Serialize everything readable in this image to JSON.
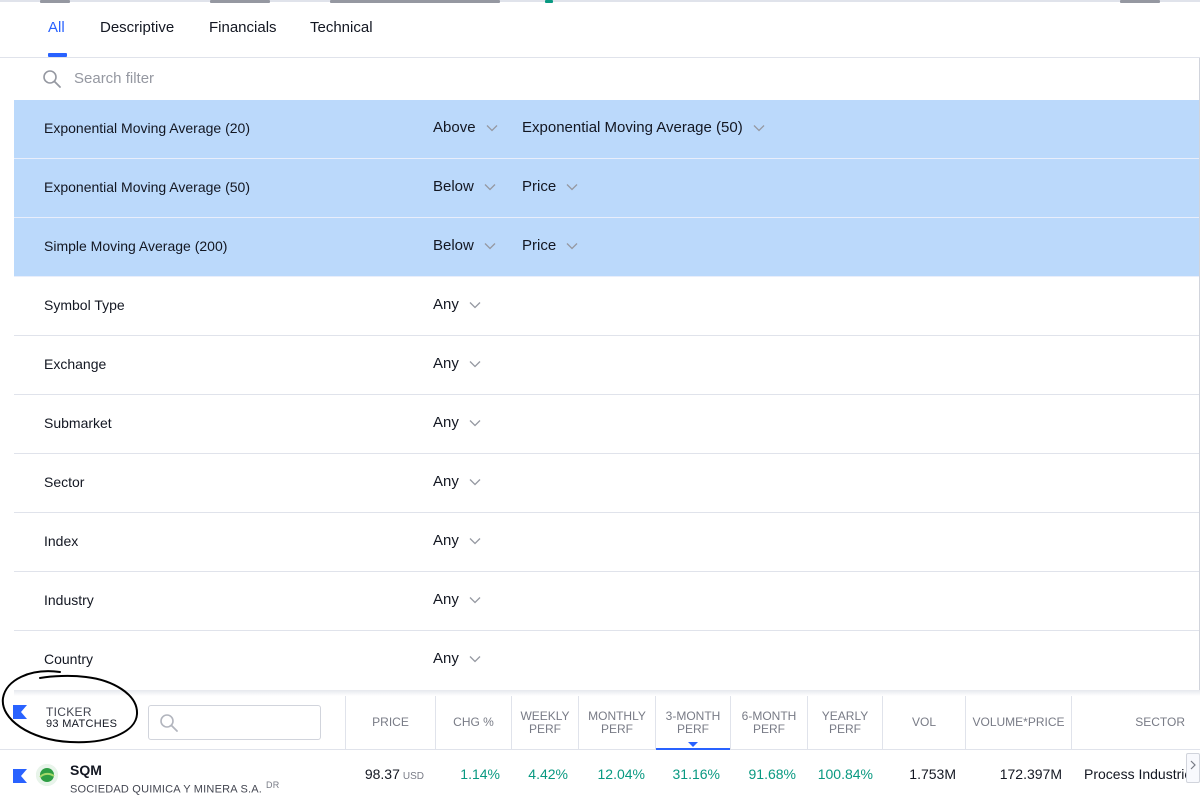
{
  "tabs": [
    {
      "label": "All",
      "active": true
    },
    {
      "label": "Descriptive",
      "active": false
    },
    {
      "label": "Financials",
      "active": false
    },
    {
      "label": "Technical",
      "active": false
    }
  ],
  "search": {
    "placeholder": "Search filter"
  },
  "filters": [
    {
      "name": "Exponential Moving Average (20)",
      "operator": "Above",
      "value": "Exponential Moving Average (50)",
      "active": true
    },
    {
      "name": "Exponential Moving Average (50)",
      "operator": "Below",
      "value": "Price",
      "active": true
    },
    {
      "name": "Simple Moving Average (200)",
      "operator": "Below",
      "value": "Price",
      "active": true
    },
    {
      "name": "Symbol Type",
      "operator": "Any",
      "active": false
    },
    {
      "name": "Exchange",
      "operator": "Any",
      "active": false
    },
    {
      "name": "Submarket",
      "operator": "Any",
      "active": false
    },
    {
      "name": "Sector",
      "operator": "Any",
      "active": false
    },
    {
      "name": "Index",
      "operator": "Any",
      "active": false
    },
    {
      "name": "Industry",
      "operator": "Any",
      "active": false
    },
    {
      "name": "Country",
      "operator": "Any",
      "active": false
    }
  ],
  "table": {
    "ticker_label": "TICKER",
    "matches_label": "93 MATCHES",
    "columns": [
      {
        "label": "PRICE"
      },
      {
        "label": "CHG %"
      },
      {
        "label": "WEEKLY PERF"
      },
      {
        "label": "MONTHLY PERF"
      },
      {
        "label": "3-MONTH PERF",
        "sorted": true
      },
      {
        "label": "6-MONTH PERF"
      },
      {
        "label": "YEARLY PERF"
      },
      {
        "label": "VOL"
      },
      {
        "label": "VOLUME*PRICE"
      },
      {
        "label": "SECTOR"
      }
    ],
    "rows": [
      {
        "symbol": "SQM",
        "description": "SOCIEDAD QUIMICA Y MINERA S.A.",
        "badge": "DR",
        "price": "98.37",
        "price_unit": "USD",
        "chg": "1.14%",
        "weekly": "4.42%",
        "monthly": "12.04%",
        "three_month": "31.16%",
        "six_month": "91.68%",
        "yearly": "100.84%",
        "vol": "1.753M",
        "volume_price": "172.397M",
        "sector": "Process Industries"
      }
    ]
  },
  "colors": {
    "accent": "#2962ff",
    "active_filter_bg": "#bbd9fb",
    "positive": "#089981",
    "annotation": "#000000"
  },
  "icons": {
    "search": "search-icon",
    "chevron": "chevron-down-icon",
    "flag": "flag-icon",
    "logo": "sqm-logo-icon",
    "scroll": "chevron-right-icon"
  }
}
